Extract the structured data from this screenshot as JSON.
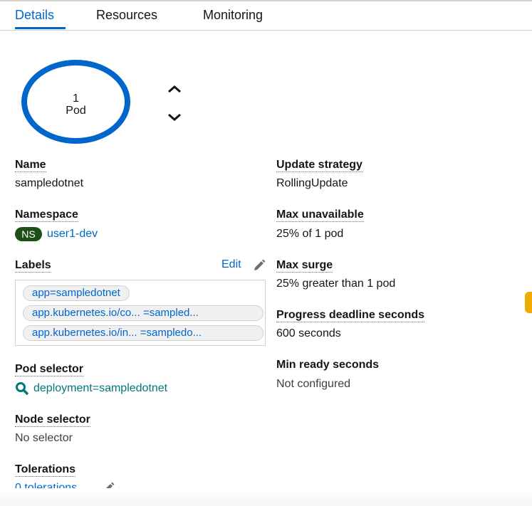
{
  "tabs": [
    {
      "label": "Details",
      "active": true
    },
    {
      "label": "Resources",
      "active": false
    },
    {
      "label": "Monitoring",
      "active": false
    }
  ],
  "pod_ring": {
    "count": "1",
    "unit": "Pod",
    "ring_color": "#0066cc"
  },
  "left": {
    "name": {
      "label": "Name",
      "value": "sampledotnet"
    },
    "namespace": {
      "label": "Namespace",
      "badge": "NS",
      "value": "user1-dev"
    },
    "labels": {
      "label": "Labels",
      "edit_label": "Edit",
      "chips": [
        "app=sampledotnet",
        "app.kubernetes.io/co... =sampled...",
        "app.kubernetes.io/in... =sampledo..."
      ]
    },
    "pod_selector": {
      "label": "Pod selector",
      "value": "deployment=sampledotnet"
    },
    "node_selector": {
      "label": "Node selector",
      "value": "No selector"
    },
    "tolerations": {
      "label": "Tolerations",
      "value": "0 tolerations"
    }
  },
  "right": {
    "update_strategy": {
      "label": "Update strategy",
      "value": "RollingUpdate"
    },
    "max_unavailable": {
      "label": "Max unavailable",
      "value": "25% of 1 pod"
    },
    "max_surge": {
      "label": "Max surge",
      "value": "25% greater than 1 pod"
    },
    "progress_deadline": {
      "label": "Progress deadline seconds",
      "value": "600 seconds"
    },
    "min_ready": {
      "label": "Min ready seconds",
      "value": "Not configured"
    }
  },
  "colors": {
    "link": "#0066cc",
    "selector_link": "#00787a",
    "ns_badge": "#1e4f18"
  }
}
